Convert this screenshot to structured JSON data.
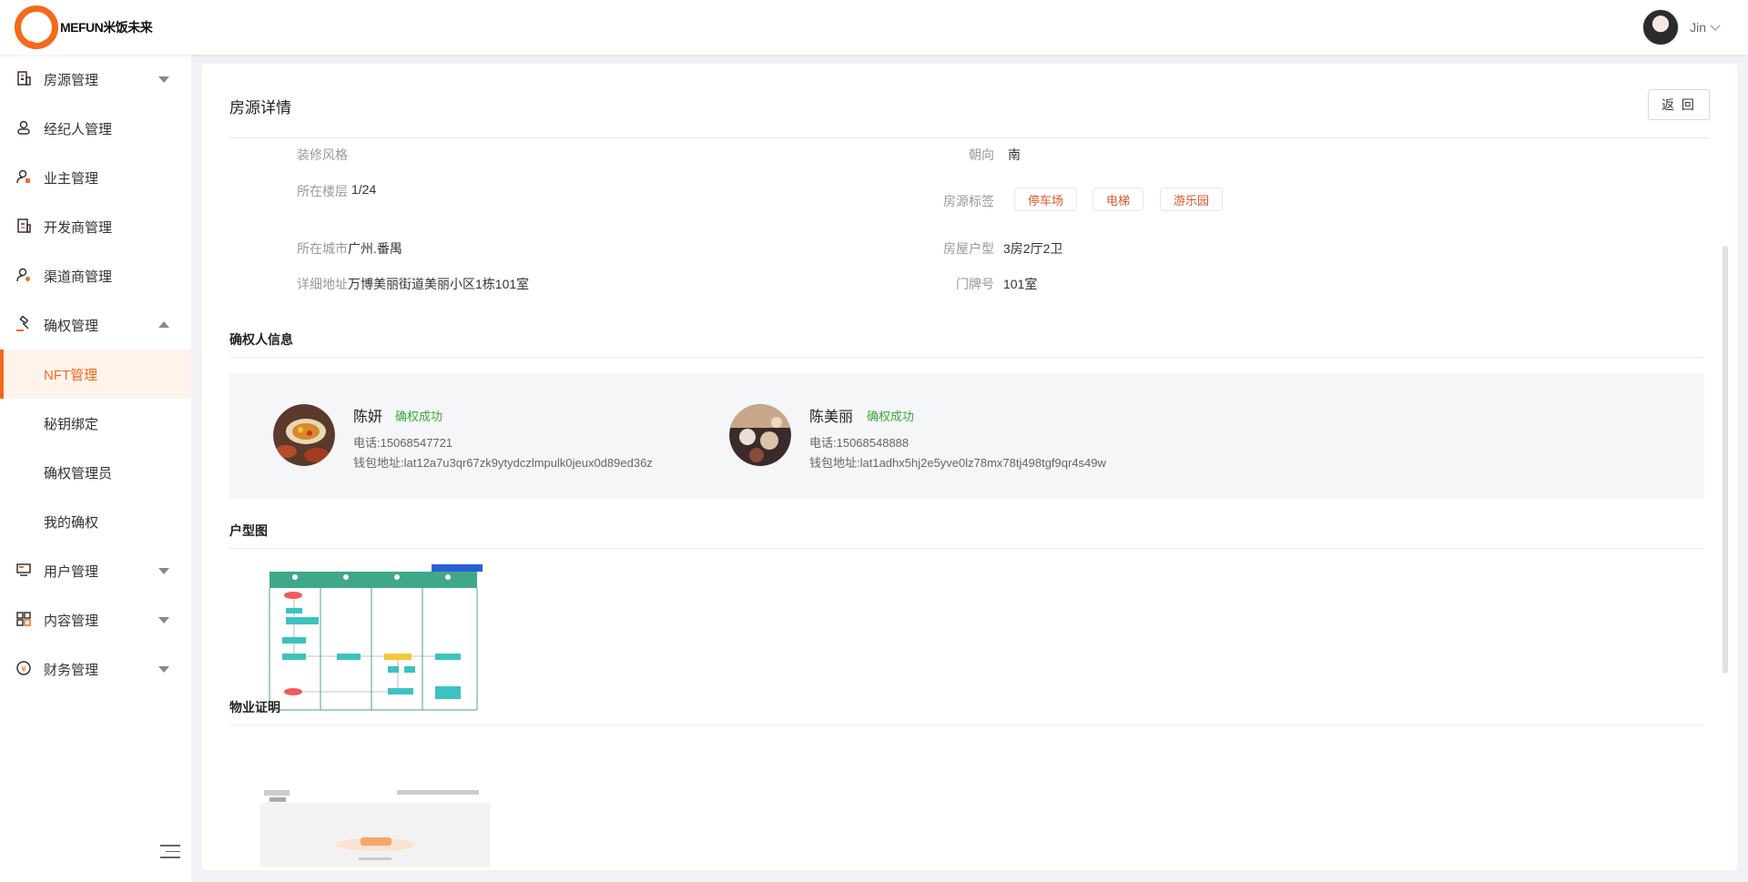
{
  "header": {
    "logo_text": "MEFUN米饭未来",
    "user_name": "Jin"
  },
  "sidebar": {
    "items": [
      {
        "label": "房源管理",
        "icon": "building-icon"
      },
      {
        "label": "经纪人管理",
        "icon": "person-icon"
      },
      {
        "label": "业主管理",
        "icon": "owner-icon"
      },
      {
        "label": "开发商管理",
        "icon": "document-icon"
      },
      {
        "label": "渠道商管理",
        "icon": "channel-icon"
      },
      {
        "label": "确权管理",
        "icon": "gavel-icon"
      }
    ],
    "sub_items": [
      {
        "label": "NFT管理"
      },
      {
        "label": "秘钥绑定"
      },
      {
        "label": "确权管理员"
      },
      {
        "label": "我的确权"
      }
    ],
    "items_after": [
      {
        "label": "用户管理",
        "icon": "monitor-icon"
      },
      {
        "label": "内容管理",
        "icon": "grid-icon"
      },
      {
        "label": "财务管理",
        "icon": "coin-icon"
      }
    ]
  },
  "page": {
    "title": "房源详情",
    "back_label": "返 回"
  },
  "details": {
    "decor_style_label": "装修风格",
    "orientation_label": "朝向",
    "orientation_value": "南",
    "floor_label": "所在楼层",
    "floor_value": "1/24",
    "tags_label": "房源标签",
    "tags": [
      "停车场",
      "电梯",
      "游乐园"
    ],
    "city_label": "所在城市",
    "city_value": "广州.番禺",
    "layout_label": "房屋户型",
    "layout_value": "3房2厅2卫",
    "address_label": "详细地址",
    "address_value": "万博美丽街道美丽小区1栋101室",
    "door_label": "门牌号",
    "door_value": "101室"
  },
  "owners_section": {
    "title": "确权人信息",
    "owners": [
      {
        "name": "陈妍",
        "status": "确权成功",
        "phone": "电话:15068547721",
        "wallet": "钱包地址:lat12a7u3qr67zk9ytydczlmpulk0jeux0d89ed36z"
      },
      {
        "name": "陈美丽",
        "status": "确权成功",
        "phone": "电话:15068548888",
        "wallet": "钱包地址:lat1adhx5hj2e5yve0lz78mx78tj498tgf9qr4s49w"
      }
    ]
  },
  "floorplan_section": {
    "title": "户型图"
  },
  "proof_section": {
    "title": "物业证明"
  },
  "colors": {
    "accent": "#f26a1b",
    "success": "#3aa93a",
    "tag_text": "#e0562a"
  }
}
